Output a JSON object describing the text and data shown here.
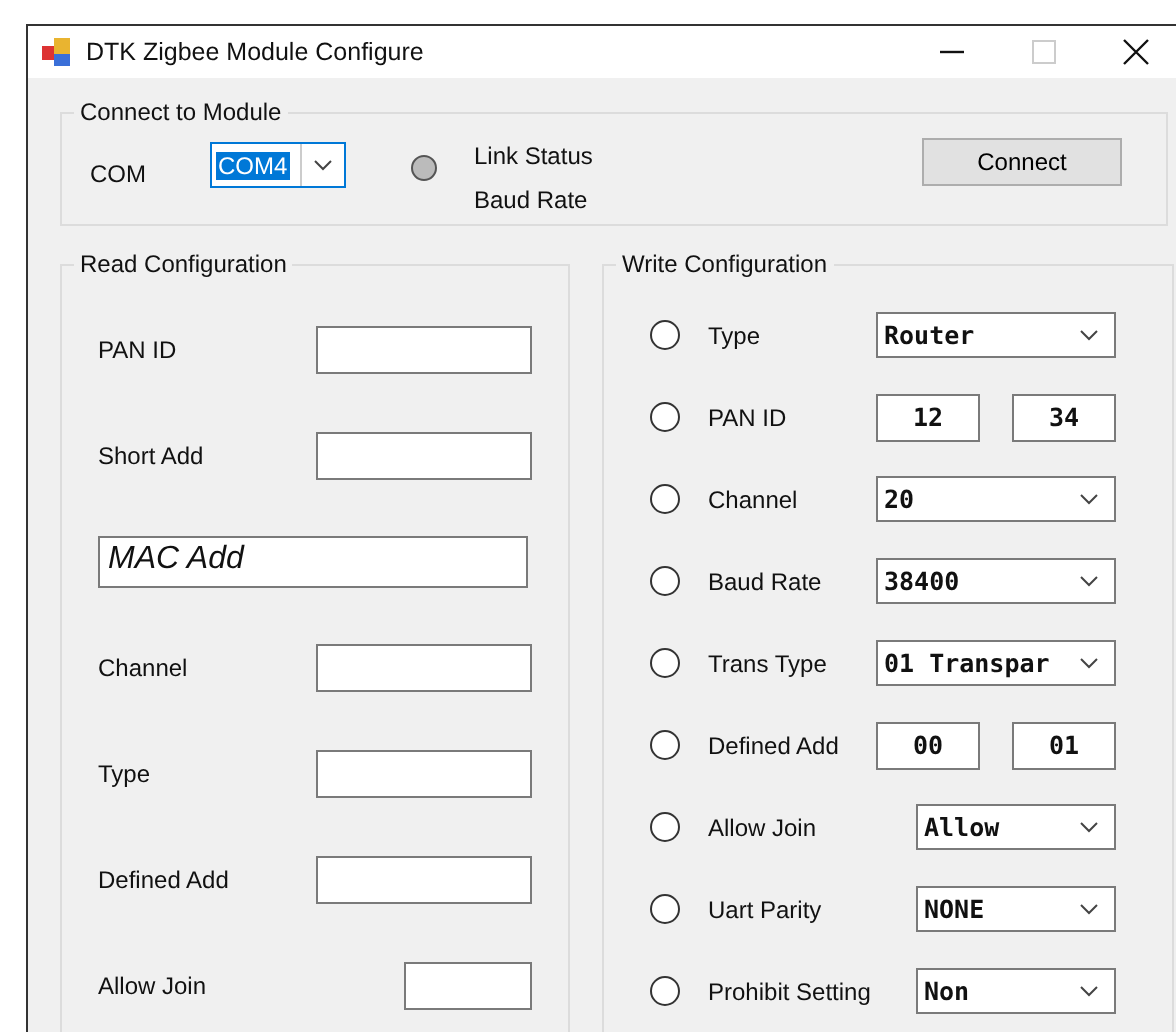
{
  "window": {
    "title": "DTK Zigbee Module Configure",
    "maximize_disabled": true
  },
  "connect": {
    "title": "Connect to Module",
    "com_label": "COM",
    "com_value": "COM4",
    "com_highlighted": true,
    "link_status": "Link Status",
    "baud_rate": "Baud Rate",
    "button": "Connect"
  },
  "read": {
    "title": "Read Configuration",
    "rows": [
      {
        "kind": "field",
        "label": "PAN ID"
      },
      {
        "kind": "field",
        "label": "Short Add"
      },
      {
        "kind": "wide",
        "value": "MAC Add"
      },
      {
        "kind": "field",
        "label": "Channel"
      },
      {
        "kind": "field",
        "label": "Type"
      },
      {
        "kind": "field",
        "label": "Defined Add"
      },
      {
        "kind": "small",
        "label": "Allow Join"
      }
    ]
  },
  "write": {
    "title": "Write Configuration",
    "rows": [
      {
        "kind": "combo",
        "label": "Type",
        "value": "Router",
        "selected": false
      },
      {
        "kind": "pair",
        "label": "PAN ID",
        "values": [
          "12",
          "34"
        ],
        "selected": false
      },
      {
        "kind": "combo",
        "label": "Channel",
        "value": "20",
        "selected": false
      },
      {
        "kind": "combo",
        "label": "Baud Rate",
        "value": "38400",
        "selected": false
      },
      {
        "kind": "combo",
        "label": "Trans Type",
        "value": "01 Transpar",
        "selected": false
      },
      {
        "kind": "pair",
        "label": "Defined Add",
        "values": [
          "00",
          "01"
        ],
        "selected": false
      },
      {
        "kind": "short",
        "label": "Allow Join",
        "value": "Allow",
        "selected": false
      },
      {
        "kind": "short",
        "label": "Uart Parity",
        "value": "NONE",
        "selected": false
      },
      {
        "kind": "short",
        "label": "Prohibit Setting",
        "value": "Non",
        "selected": false
      }
    ]
  }
}
